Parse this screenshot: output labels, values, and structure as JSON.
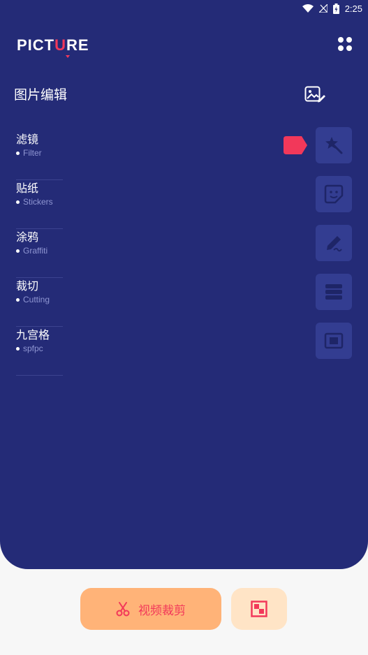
{
  "status": {
    "time": "2:25"
  },
  "app": {
    "logo_pre": "PICT",
    "logo_accent": "U",
    "logo_post": "RE"
  },
  "page": {
    "title": "图片编辑"
  },
  "menu": [
    {
      "cn": "滤镜",
      "en": "Filter"
    },
    {
      "cn": "贴纸",
      "en": "Stickers"
    },
    {
      "cn": "涂鸦",
      "en": "Graffiti"
    },
    {
      "cn": "裁切",
      "en": "Cutting"
    },
    {
      "cn": "九宫格",
      "en": "spfpc"
    }
  ],
  "bottom": {
    "video_label": "视频裁剪"
  },
  "colors": {
    "panel": "#242b77",
    "accent": "#f2385a",
    "tool_bg": "#333d91",
    "orange": "#ffb378",
    "peach": "#ffe4c6"
  },
  "icons": [
    "wifi-icon",
    "signal-icon",
    "battery-icon",
    "menu-dots-icon",
    "image-edit-icon",
    "magic-wand-icon",
    "sticker-icon",
    "pencil-icon",
    "layers-icon",
    "frame-icon",
    "scissors-icon",
    "grid-square-icon"
  ]
}
